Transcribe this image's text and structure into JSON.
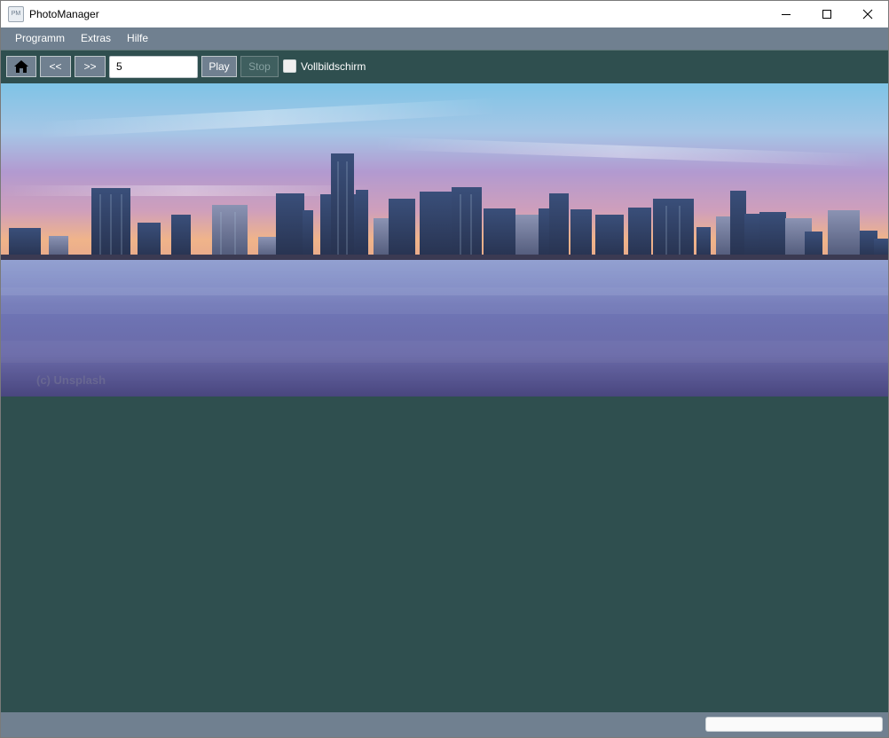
{
  "window": {
    "title": "PhotoManager",
    "icon_text": "PM"
  },
  "menu": {
    "items": [
      "Programm",
      "Extras",
      "Hilfe"
    ]
  },
  "toolbar": {
    "home_icon": "home-icon",
    "prev_label": "<<",
    "next_label": ">>",
    "interval_value": "5",
    "play_label": "Play",
    "stop_label": "Stop",
    "fullscreen_label": "Vollbildschirm",
    "fullscreen_checked": false
  },
  "image": {
    "watermark": "(c) Unsplash"
  },
  "status": {
    "progress": 0
  },
  "colors": {
    "background": "#2f4f4f",
    "bars": "#708090"
  }
}
